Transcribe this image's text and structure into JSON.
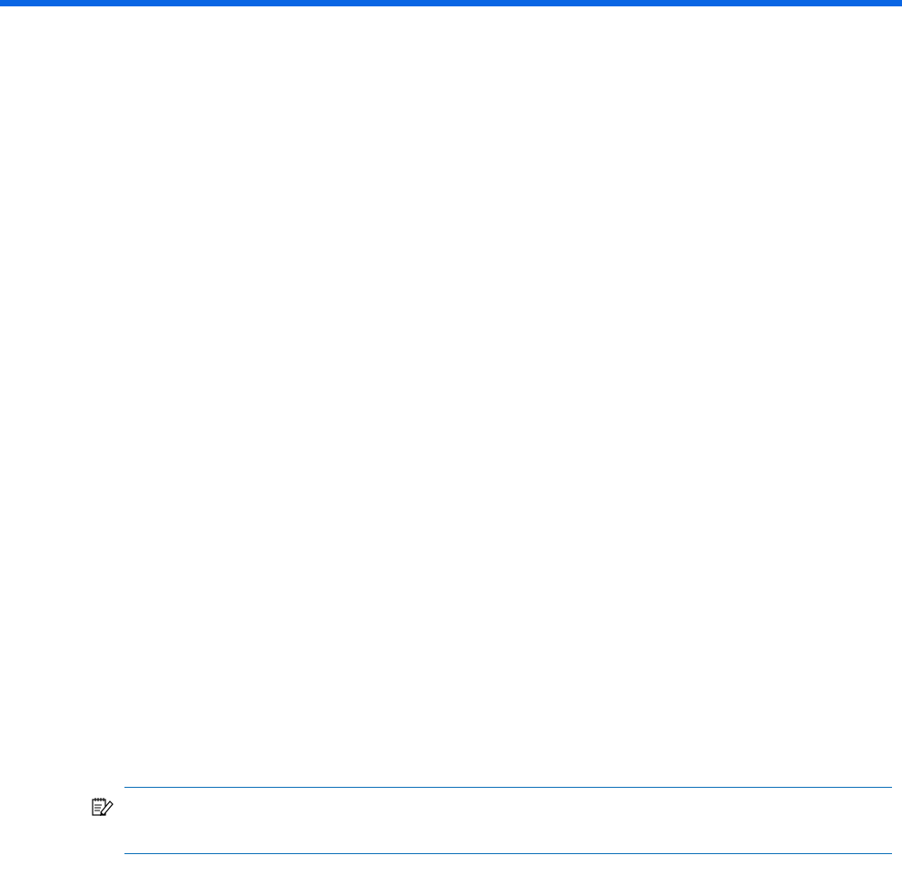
{
  "colors": {
    "header_bar": "#0a66e4",
    "rule": "#0b6fb8",
    "background": "#ffffff"
  },
  "note": {
    "icon": "note-pencil-icon",
    "text": ""
  }
}
